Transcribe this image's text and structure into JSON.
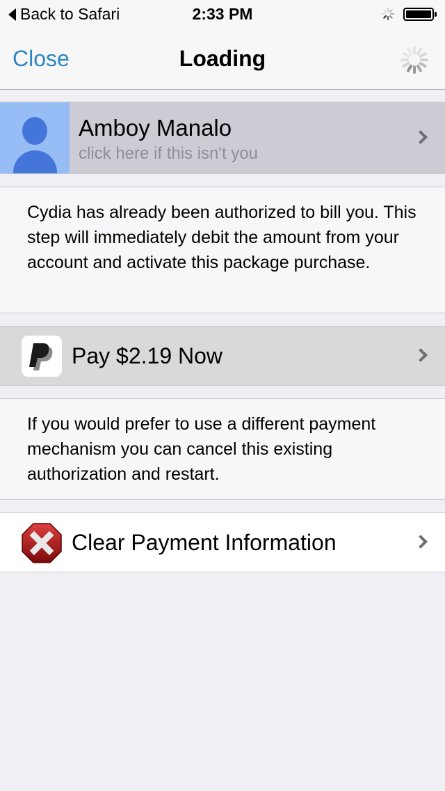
{
  "status_bar": {
    "back_label": "Back to Safari",
    "time": "2:33 PM",
    "activity_icon": "spinner-icon",
    "battery_icon": "battery-icon",
    "battery_level": 1.0
  },
  "nav_bar": {
    "close_label": "Close",
    "title": "Loading",
    "loading_icon": "spinner-icon"
  },
  "user": {
    "name": "Amboy Manalo",
    "subtitle": "click here if this isn't you",
    "avatar_icon": "person-icon"
  },
  "info_authorized": "Cydia has already been authorized to bill you. This step will immediately debit the amount from your account and activate this package purchase.",
  "pay_button": {
    "label": "Pay $2.19 Now",
    "icon": "paypal-icon"
  },
  "info_cancel": "If you would prefer to use a different payment mechanism you can cancel this existing authorization and restart.",
  "clear_button": {
    "label": "Clear Payment Information",
    "icon": "stop-x-icon"
  },
  "colors": {
    "accent": "#2e86c1",
    "avatar_bg": "#96bdf6",
    "avatar_fg": "#4376d8",
    "user_cell_bg": "#cdccd4",
    "pay_cell_bg": "#d9d9d9",
    "page_bg": "#efeff4"
  }
}
